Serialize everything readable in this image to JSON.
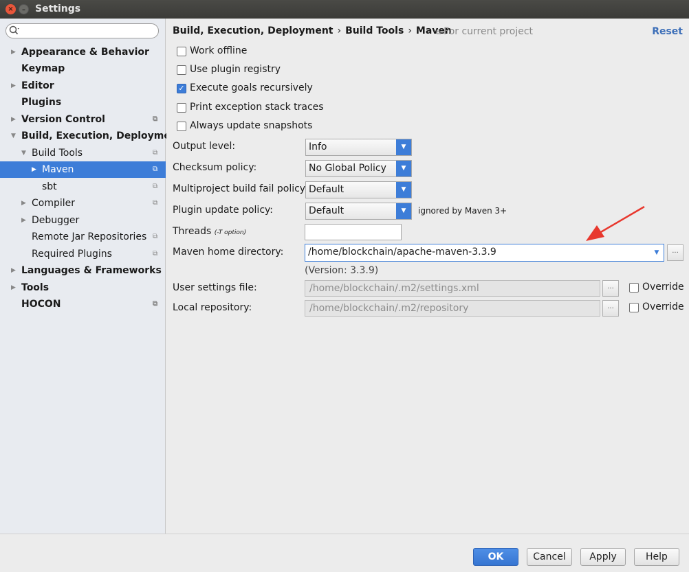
{
  "window": {
    "title": "Settings",
    "close_glyph": "×",
    "min_glyph": "–"
  },
  "sidebar": {
    "search_placeholder": "",
    "search_icon": "search-icon",
    "items": [
      {
        "label": "Appearance & Behavior",
        "bold": true,
        "arrow": "▶"
      },
      {
        "label": "Keymap",
        "bold": true
      },
      {
        "label": "Editor",
        "bold": true,
        "arrow": "▶"
      },
      {
        "label": "Plugins",
        "bold": true
      },
      {
        "label": "Version Control",
        "bold": true,
        "arrow": "▶",
        "project": true
      },
      {
        "label": "Build, Execution, Deployment",
        "bold": true,
        "arrow": "▼"
      },
      {
        "label": "Build Tools",
        "arrow": "▼",
        "project": true
      },
      {
        "label": "Maven",
        "arrow": "▶",
        "project": true,
        "selected": true
      },
      {
        "label": "sbt",
        "project": true
      },
      {
        "label": "Compiler",
        "arrow": "▶",
        "project": true
      },
      {
        "label": "Debugger",
        "arrow": "▶"
      },
      {
        "label": "Remote Jar Repositories",
        "project": true
      },
      {
        "label": "Required Plugins",
        "project": true
      },
      {
        "label": "Languages & Frameworks",
        "bold": true,
        "arrow": "▶"
      },
      {
        "label": "Tools",
        "bold": true,
        "arrow": "▶"
      },
      {
        "label": "HOCON",
        "bold": true,
        "project": true
      }
    ],
    "project_glyph": "⧉"
  },
  "header": {
    "crumb1": "Build, Execution, Deployment",
    "crumb2": "Build Tools",
    "crumb3": "Maven",
    "sep": "›",
    "for_project": "For current project",
    "for_project_glyph": "⧉",
    "reset": "Reset"
  },
  "options": {
    "work_offline": {
      "label": "Work offline",
      "checked": false
    },
    "use_plugin_registry": {
      "label": "Use plugin registry",
      "checked": false
    },
    "execute_goals": {
      "label": "Execute goals recursively",
      "checked": true
    },
    "print_exception": {
      "label": "Print exception stack traces",
      "checked": false
    },
    "always_update": {
      "label": "Always update snapshots",
      "checked": false
    },
    "check_glyph": "✓"
  },
  "fields": {
    "output_level": {
      "label": "Output level:",
      "value": "Info"
    },
    "checksum_policy": {
      "label": "Checksum policy:",
      "value": "No Global Policy"
    },
    "multiproject_fail": {
      "label": "Multiproject build fail policy:",
      "value": "Default"
    },
    "plugin_update": {
      "label": "Plugin update policy:",
      "value": "Default",
      "hint": "ignored by Maven 3+"
    },
    "threads": {
      "label": "Threads",
      "sub": "(-T option)",
      "value": ""
    },
    "maven_home": {
      "label": "Maven home directory:",
      "value": "/home/blockchain/apache-maven-3.3.9",
      "version": "(Version: 3.3.9)"
    },
    "user_settings": {
      "label": "User settings file:",
      "value": "/home/blockchain/.m2/settings.xml",
      "override": "Override"
    },
    "local_repo": {
      "label": "Local repository:",
      "value": "/home/blockchain/.m2/repository",
      "override": "Override"
    },
    "dropdown_glyph": "▼",
    "browse_glyph": "..."
  },
  "footer": {
    "ok": "OK",
    "cancel": "Cancel",
    "apply": "Apply",
    "help": "Help"
  },
  "colors": {
    "accent": "#3d7dd8",
    "annotation_arrow": "#e8382e"
  }
}
